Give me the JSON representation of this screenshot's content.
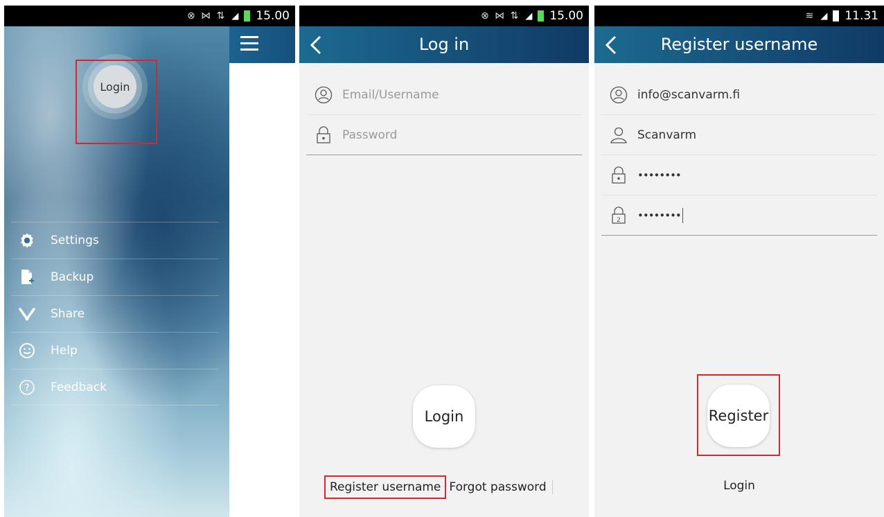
{
  "screen1": {
    "status": {
      "icons": "⊗ ⋈ ⇅",
      "time": "15.00"
    },
    "profile": {
      "login_label": "Login"
    },
    "menu": [
      {
        "label": "Settings",
        "icon": "gear-icon"
      },
      {
        "label": "Backup",
        "icon": "file-add-icon"
      },
      {
        "label": "Share",
        "icon": "share-icon"
      },
      {
        "label": "Help",
        "icon": "smiley-icon"
      },
      {
        "label": "Feedback",
        "icon": "question-circle-icon"
      }
    ]
  },
  "screen2": {
    "status": {
      "icons": "⊗ ⋈ ⇅",
      "time": "15.00"
    },
    "title": "Log in",
    "fields": {
      "email_placeholder": "Email/Username",
      "password_placeholder": "Password"
    },
    "login_button": "Login",
    "register_link": "Register username",
    "forgot_link": "Forgot password"
  },
  "screen3": {
    "status": {
      "icons": "≋",
      "time": "11.31"
    },
    "title": "Register username",
    "fields": {
      "email_value": "info@scanvarm.fi",
      "username_value": "Scanvarm",
      "password_value": "••••••••",
      "confirm_password_value": "••••••••"
    },
    "register_button": "Register",
    "login_link": "Login"
  },
  "colors": {
    "accent_red": "#d9262c",
    "appbar_blue": "#14507c",
    "battery_green": "#5cd65c"
  }
}
